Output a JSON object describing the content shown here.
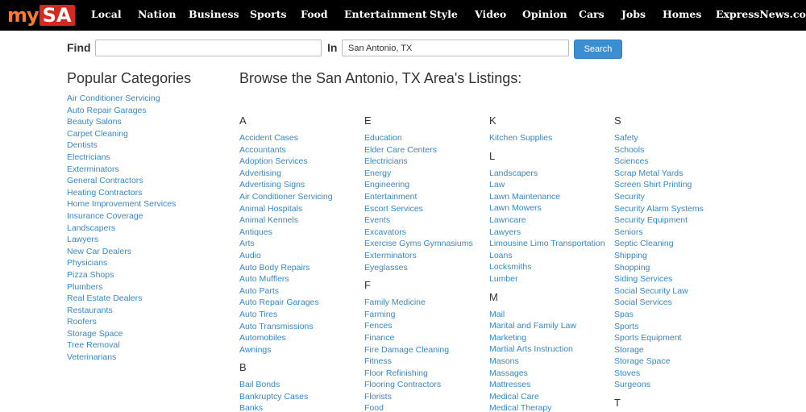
{
  "logo": {
    "part1": "my",
    "part2": "SA"
  },
  "nav": [
    "Local",
    "Nation",
    "Business",
    "Sports",
    "Food",
    "Entertainment",
    "Style",
    "Video",
    "Opinion",
    "Cars",
    "Jobs",
    "Homes",
    "ExpressNews.com"
  ],
  "search": {
    "find_label": "Find",
    "find_value": "",
    "in_label": "In",
    "in_value": "San Antonio, TX",
    "button_label": "Search"
  },
  "popular": {
    "title": "Popular Categories",
    "items": [
      "Air Conditioner Servicing",
      "Auto Repair Garages",
      "Beauty Salons",
      "Carpet Cleaning",
      "Dentists",
      "Electricians",
      "Exterminators",
      "General Contractors",
      "Heating Contractors",
      "Home Improvement Services",
      "Insurance Coverage",
      "Landscapers",
      "Lawyers",
      "New Car Dealers",
      "Physicians",
      "Pizza Shops",
      "Plumbers",
      "Real Estate Dealers",
      "Restaurants",
      "Roofers",
      "Storage Space",
      "Tree Removal",
      "Veterinarians"
    ]
  },
  "browse": {
    "title": "Browse the San Antonio, TX Area's Listings:",
    "columns": [
      [
        {
          "letter": "A",
          "items": [
            "Accident Cases",
            "Accountants",
            "Adoption Services",
            "Advertising",
            "Advertising Signs",
            "Air Conditioner Servicing",
            "Animal Hospitals",
            "Animal Kennels",
            "Antiques",
            "Arts",
            "Audio",
            "Auto Body Repairs",
            "Auto Mufflers",
            "Auto Parts",
            "Auto Repair Garages",
            "Auto Tires",
            "Auto Transmissions",
            "Automobiles",
            "Awnings"
          ]
        },
        {
          "letter": "B",
          "items": [
            "Bail Bonds",
            "Bankruptcy Cases",
            "Banks"
          ]
        }
      ],
      [
        {
          "letter": "E",
          "items": [
            "Education",
            "Elder Care Centers",
            "Electricians",
            "Energy",
            "Engineering",
            "Entertainment",
            "Escort Services",
            "Events",
            "Excavators",
            "Exercise Gyms Gymnasiums",
            "Exterminators",
            "Eyeglasses"
          ]
        },
        {
          "letter": "F",
          "items": [
            "Family Medicine",
            "Farming",
            "Fences",
            "Finance",
            "Fire Damage Cleaning",
            "Fitness",
            "Floor Refinishing",
            "Flooring Contractors",
            "Florists",
            "Food"
          ]
        }
      ],
      [
        {
          "letter": "K",
          "items": [
            "Kitchen Supplies"
          ]
        },
        {
          "letter": "L",
          "items": [
            "Landscapers",
            "Law",
            "Lawn Maintenance",
            "Lawn Mowers",
            "Lawncare",
            "Lawyers",
            "Limousine Limo Transportation",
            "Loans",
            "Locksmiths",
            "Lumber"
          ]
        },
        {
          "letter": "M",
          "items": [
            "Mail",
            "Marital and Family Law",
            "Marketing",
            "Martial Arts Instruction",
            "Masons",
            "Massages",
            "Mattresses",
            "Medical Care",
            "Medical Therapy"
          ]
        }
      ],
      [
        {
          "letter": "S",
          "items": [
            "Safety",
            "Schools",
            "Sciences",
            "Scrap Metal Yards",
            "Screen Shirt Printing",
            "Security",
            "Security Alarm Systems",
            "Security Equipment",
            "Seniors",
            "Septic Cleaning",
            "Shipping",
            "Shopping",
            "Siding Services",
            "Social Security Law",
            "Social Services",
            "Spas",
            "Sports",
            "Sports Equipment",
            "Storage",
            "Storage Space",
            "Stoves",
            "Surgeons"
          ]
        },
        {
          "letter": "T",
          "items": []
        }
      ]
    ]
  }
}
